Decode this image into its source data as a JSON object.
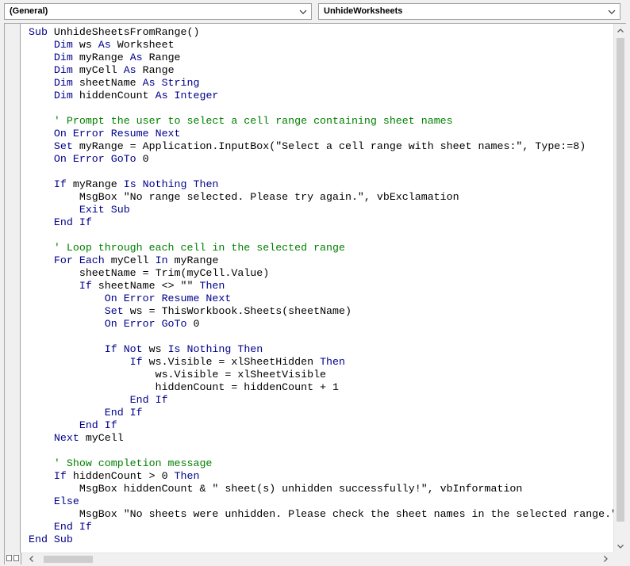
{
  "general_dropdown": {
    "value": "(General)"
  },
  "procedure_dropdown": {
    "value": "UnhideWorksheets"
  },
  "colors": {
    "keyword": "#00008b",
    "comment": "#008000",
    "text": "#000000"
  },
  "code_lines": [
    [
      [
        "kw",
        "Sub "
      ],
      [
        "tx",
        "UnhideSheetsFromRange()"
      ]
    ],
    [
      [
        "tx",
        "    "
      ],
      [
        "kw",
        "Dim "
      ],
      [
        "tx",
        "ws "
      ],
      [
        "kw",
        "As "
      ],
      [
        "tx",
        "Worksheet"
      ]
    ],
    [
      [
        "tx",
        "    "
      ],
      [
        "kw",
        "Dim "
      ],
      [
        "tx",
        "myRange "
      ],
      [
        "kw",
        "As "
      ],
      [
        "tx",
        "Range"
      ]
    ],
    [
      [
        "tx",
        "    "
      ],
      [
        "kw",
        "Dim "
      ],
      [
        "tx",
        "myCell "
      ],
      [
        "kw",
        "As "
      ],
      [
        "tx",
        "Range"
      ]
    ],
    [
      [
        "tx",
        "    "
      ],
      [
        "kw",
        "Dim "
      ],
      [
        "tx",
        "sheetName "
      ],
      [
        "kw",
        "As String"
      ]
    ],
    [
      [
        "tx",
        "    "
      ],
      [
        "kw",
        "Dim "
      ],
      [
        "tx",
        "hiddenCount "
      ],
      [
        "kw",
        "As Integer"
      ]
    ],
    [
      [
        "tx",
        ""
      ]
    ],
    [
      [
        "tx",
        "    "
      ],
      [
        "cm",
        "' Prompt the user to select a cell range containing sheet names"
      ]
    ],
    [
      [
        "tx",
        "    "
      ],
      [
        "kw",
        "On Error Resume Next"
      ]
    ],
    [
      [
        "tx",
        "    "
      ],
      [
        "kw",
        "Set "
      ],
      [
        "tx",
        "myRange = Application.InputBox(\"Select a cell range with sheet names:\", Type:=8)"
      ]
    ],
    [
      [
        "tx",
        "    "
      ],
      [
        "kw",
        "On Error GoTo "
      ],
      [
        "tx",
        "0"
      ]
    ],
    [
      [
        "tx",
        ""
      ]
    ],
    [
      [
        "tx",
        "    "
      ],
      [
        "kw",
        "If "
      ],
      [
        "tx",
        "myRange "
      ],
      [
        "kw",
        "Is Nothing Then"
      ]
    ],
    [
      [
        "tx",
        "        MsgBox \"No range selected. Please try again.\", vbExclamation"
      ]
    ],
    [
      [
        "tx",
        "        "
      ],
      [
        "kw",
        "Exit Sub"
      ]
    ],
    [
      [
        "tx",
        "    "
      ],
      [
        "kw",
        "End If"
      ]
    ],
    [
      [
        "tx",
        ""
      ]
    ],
    [
      [
        "tx",
        "    "
      ],
      [
        "cm",
        "' Loop through each cell in the selected range"
      ]
    ],
    [
      [
        "tx",
        "    "
      ],
      [
        "kw",
        "For Each "
      ],
      [
        "tx",
        "myCell "
      ],
      [
        "kw",
        "In "
      ],
      [
        "tx",
        "myRange"
      ]
    ],
    [
      [
        "tx",
        "        sheetName = Trim(myCell.Value)"
      ]
    ],
    [
      [
        "tx",
        "        "
      ],
      [
        "kw",
        "If "
      ],
      [
        "tx",
        "sheetName <> \"\" "
      ],
      [
        "kw",
        "Then"
      ]
    ],
    [
      [
        "tx",
        "            "
      ],
      [
        "kw",
        "On Error Resume Next"
      ]
    ],
    [
      [
        "tx",
        "            "
      ],
      [
        "kw",
        "Set "
      ],
      [
        "tx",
        "ws = ThisWorkbook.Sheets(sheetName)"
      ]
    ],
    [
      [
        "tx",
        "            "
      ],
      [
        "kw",
        "On Error GoTo "
      ],
      [
        "tx",
        "0"
      ]
    ],
    [
      [
        "tx",
        ""
      ]
    ],
    [
      [
        "tx",
        "            "
      ],
      [
        "kw",
        "If Not "
      ],
      [
        "tx",
        "ws "
      ],
      [
        "kw",
        "Is Nothing Then"
      ]
    ],
    [
      [
        "tx",
        "                "
      ],
      [
        "kw",
        "If "
      ],
      [
        "tx",
        "ws.Visible = xlSheetHidden "
      ],
      [
        "kw",
        "Then"
      ]
    ],
    [
      [
        "tx",
        "                    ws.Visible = xlSheetVisible"
      ]
    ],
    [
      [
        "tx",
        "                    hiddenCount = hiddenCount + 1"
      ]
    ],
    [
      [
        "tx",
        "                "
      ],
      [
        "kw",
        "End If"
      ]
    ],
    [
      [
        "tx",
        "            "
      ],
      [
        "kw",
        "End If"
      ]
    ],
    [
      [
        "tx",
        "        "
      ],
      [
        "kw",
        "End If"
      ]
    ],
    [
      [
        "tx",
        "    "
      ],
      [
        "kw",
        "Next "
      ],
      [
        "tx",
        "myCell"
      ]
    ],
    [
      [
        "tx",
        ""
      ]
    ],
    [
      [
        "tx",
        "    "
      ],
      [
        "cm",
        "' Show completion message"
      ]
    ],
    [
      [
        "tx",
        "    "
      ],
      [
        "kw",
        "If "
      ],
      [
        "tx",
        "hiddenCount > 0 "
      ],
      [
        "kw",
        "Then"
      ]
    ],
    [
      [
        "tx",
        "        MsgBox hiddenCount & \" sheet(s) unhidden successfully!\", vbInformation"
      ]
    ],
    [
      [
        "tx",
        "    "
      ],
      [
        "kw",
        "Else"
      ]
    ],
    [
      [
        "tx",
        "        MsgBox \"No sheets were unhidden. Please check the sheet names in the selected range.\", vbExclamation"
      ]
    ],
    [
      [
        "tx",
        "    "
      ],
      [
        "kw",
        "End If"
      ]
    ],
    [
      [
        "kw",
        "End Sub"
      ]
    ]
  ]
}
